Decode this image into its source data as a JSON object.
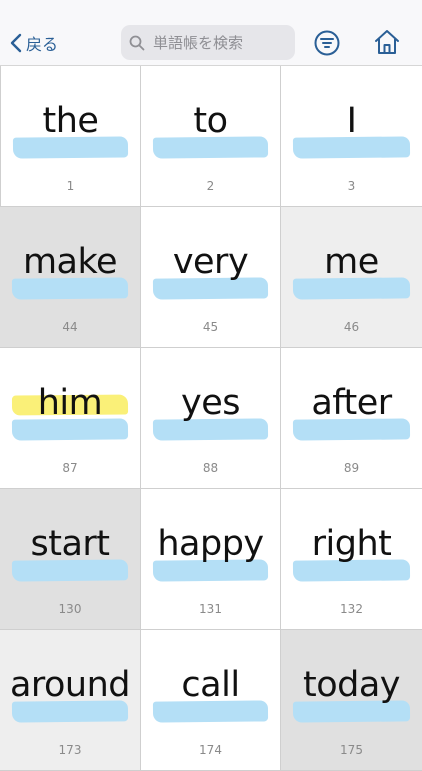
{
  "header": {
    "back_label": "戻る",
    "search_placeholder": "単語帳を検索"
  },
  "colors": {
    "accent": "#2a5f96",
    "highlight_blue": "#b4dff6",
    "highlight_yellow": "#faf078"
  },
  "words": [
    {
      "word": "the",
      "number": "1",
      "shade": "0",
      "starred": false
    },
    {
      "word": "to",
      "number": "2",
      "shade": "0",
      "starred": false
    },
    {
      "word": "I",
      "number": "3",
      "shade": "0",
      "starred": false
    },
    {
      "word": "make",
      "number": "44",
      "shade": "2",
      "starred": false
    },
    {
      "word": "very",
      "number": "45",
      "shade": "0",
      "starred": false
    },
    {
      "word": "me",
      "number": "46",
      "shade": "1",
      "starred": false
    },
    {
      "word": "him",
      "number": "87",
      "shade": "0",
      "starred": true
    },
    {
      "word": "yes",
      "number": "88",
      "shade": "0",
      "starred": false
    },
    {
      "word": "after",
      "number": "89",
      "shade": "0",
      "starred": false
    },
    {
      "word": "start",
      "number": "130",
      "shade": "2",
      "starred": false
    },
    {
      "word": "happy",
      "number": "131",
      "shade": "0",
      "starred": false
    },
    {
      "word": "right",
      "number": "132",
      "shade": "0",
      "starred": false
    },
    {
      "word": "around",
      "number": "173",
      "shade": "1",
      "starred": false
    },
    {
      "word": "call",
      "number": "174",
      "shade": "0",
      "starred": false
    },
    {
      "word": "today",
      "number": "175",
      "shade": "2",
      "starred": false
    }
  ]
}
